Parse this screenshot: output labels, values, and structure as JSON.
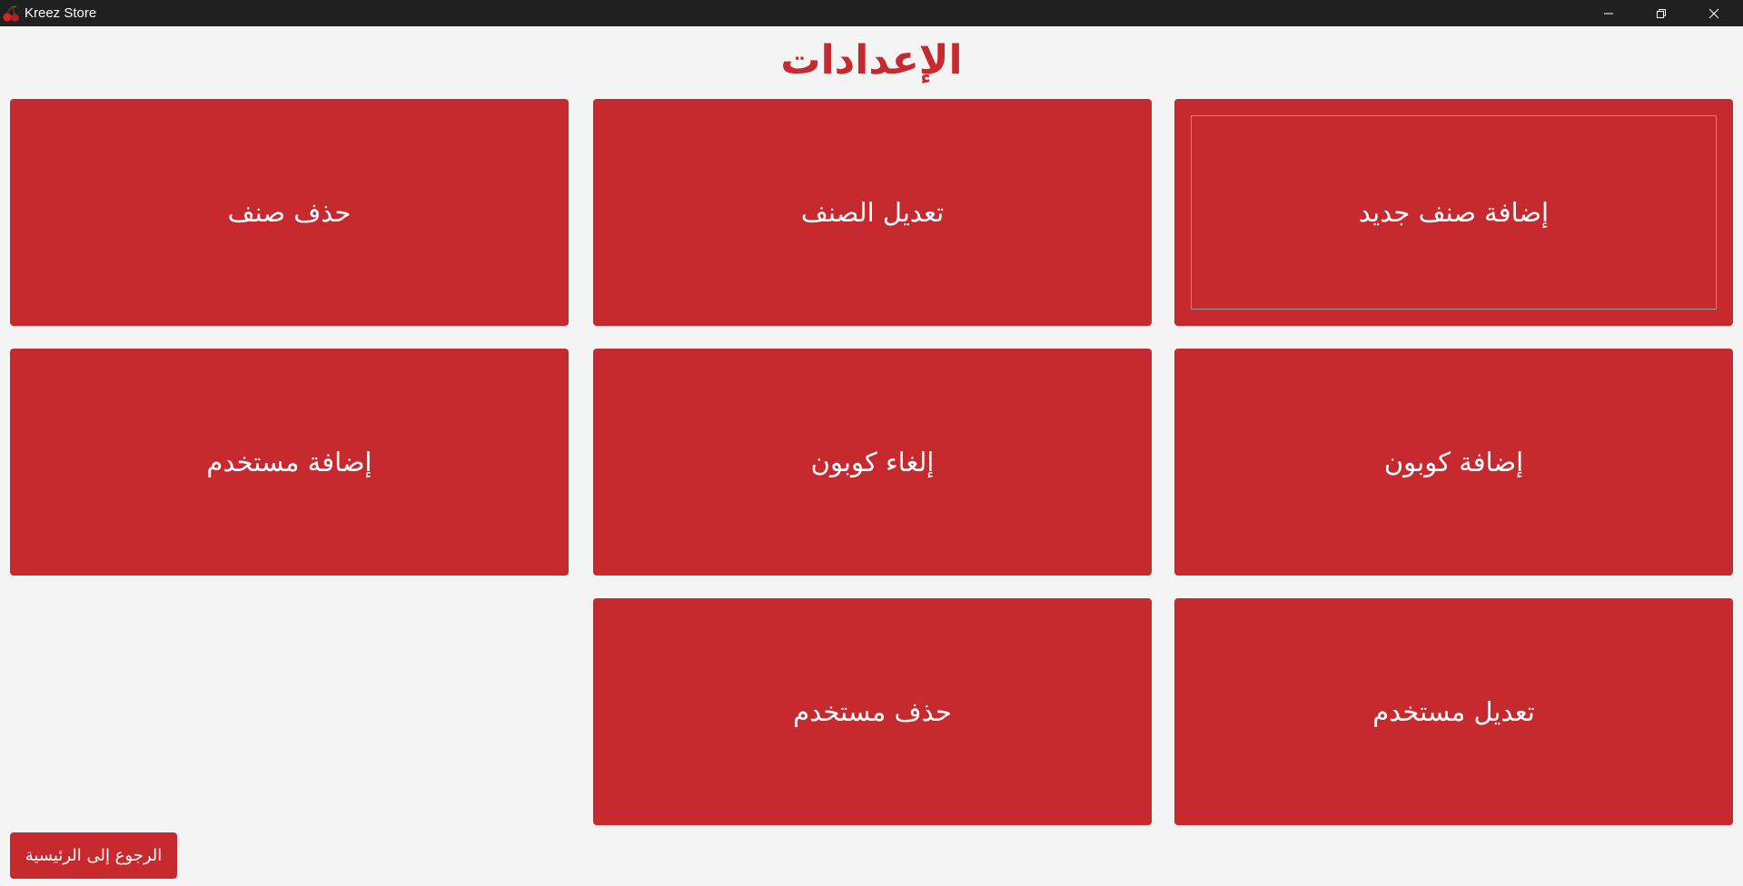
{
  "window": {
    "title": "Kreez Store",
    "icon": "cherries-icon",
    "controls": [
      "minimize-icon",
      "restore-icon",
      "close-icon"
    ]
  },
  "page": {
    "title": "الإعدادات",
    "accent_color": "#c62a2f",
    "background_color": "#f4f4f4"
  },
  "tiles": [
    {
      "label": "إضافة صنف جديد",
      "focused": true
    },
    {
      "label": "تعديل الصنف"
    },
    {
      "label": "حذف صنف"
    },
    {
      "label": "إضافة كوبون"
    },
    {
      "label": "إلغاء كوبون"
    },
    {
      "label": "إضافة مستخدم"
    },
    {
      "label": "تعديل مستخدم"
    },
    {
      "label": "حذف مستخدم"
    }
  ],
  "footer": {
    "back_label": "الرجوع إلى الرئيسية"
  }
}
